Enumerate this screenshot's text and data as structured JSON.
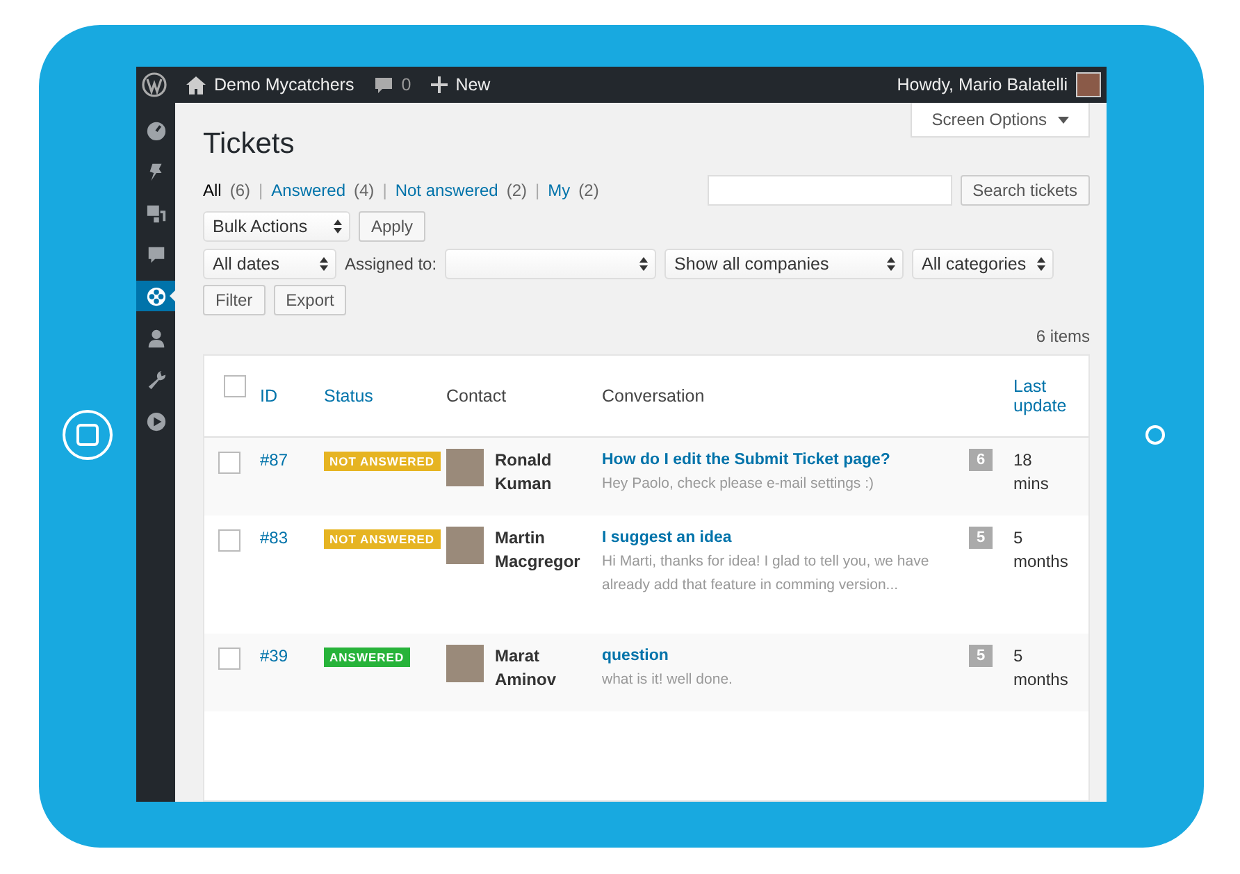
{
  "admin_bar": {
    "site": "Demo Mycatchers",
    "comments": "0",
    "new": "New",
    "greeting": "Howdy, Mario Balatelli"
  },
  "sidebar": {
    "items": [
      {
        "selected": false
      },
      {
        "selected": false
      },
      {
        "selected": false
      },
      {
        "selected": false
      },
      {
        "selected": true
      },
      {
        "selected": false
      },
      {
        "selected": false
      },
      {
        "selected": false
      }
    ]
  },
  "screen_options": "Screen Options",
  "title": "Tickets",
  "views": [
    {
      "label": "All",
      "count": "(6)",
      "selected": true
    },
    {
      "separator": "|",
      "label": "Answered",
      "count": "(4)",
      "selected": false
    },
    {
      "separator": "|",
      "label": "Not answered",
      "count": "(2)",
      "selected": false
    },
    {
      "separator": "|",
      "label": "My",
      "count": "(2)",
      "selected": false
    }
  ],
  "search": {
    "button": "Search tickets"
  },
  "bulk_actions": {
    "value": "Bulk Actions",
    "button": "Apply"
  },
  "filters": {
    "dates": "All dates",
    "assigned_label": "Assigned to:",
    "companies": "Show all companies",
    "categories": "All categories",
    "filter_button": "Filter",
    "export_button": "Export"
  },
  "item_count": "6 items",
  "table": {
    "columns": [
      "ID",
      "Status",
      "Contact",
      "Conversation",
      "Last update"
    ],
    "select_all_checked": false,
    "rows": [
      {
        "checked": false,
        "id": "#87",
        "status": "NOT ANSWERED",
        "color": "#e6b422",
        "contact": "Ronald Kuman",
        "subject": "How do I edit the Submit Ticket page?",
        "excerpt": "Hey Paolo, check please e-mail settings :)",
        "replies": "6",
        "updated": "18 mins"
      },
      {
        "checked": false,
        "id": "#83",
        "status": "NOT ANSWERED",
        "color": "#e6b422",
        "contact": "Martin Macgregor",
        "subject": "I suggest an idea",
        "excerpt": "Hi Marti, thanks for idea! I glad to tell you, we have already add that feature in comming version...",
        "replies": "5",
        "updated": "5 months"
      },
      {
        "checked": false,
        "id": "#39",
        "status": "ANSWERED",
        "color": "#27b33a",
        "contact": "Marat Aminov",
        "subject": "question",
        "excerpt": "what is it!  well done.",
        "replies": "5",
        "updated": "5 months"
      }
    ]
  }
}
